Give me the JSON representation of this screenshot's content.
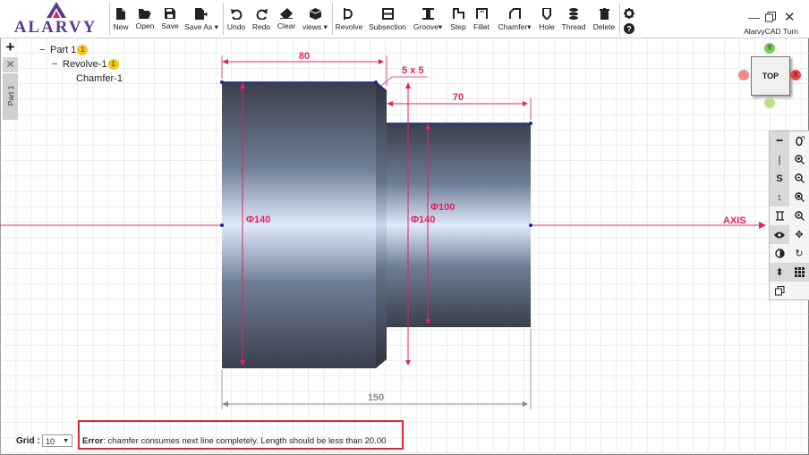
{
  "app": {
    "logo_text": "ALARVY",
    "title": "AlarvyCAD Turn"
  },
  "toolbar": {
    "file": [
      "New",
      "Open",
      "Save",
      "Save As"
    ],
    "edit": [
      "Undo",
      "Redo",
      "Clear",
      "views"
    ],
    "features": [
      "Revolve",
      "Subsection",
      "Groove",
      "Step",
      "Fillet",
      "Chamfer",
      "Hole",
      "Thread",
      "Delete"
    ]
  },
  "tabs": {
    "part_tab": "Part 1"
  },
  "tree": {
    "part": "Part 1",
    "part_badge": "1",
    "revolve": "Revolve-1",
    "revolve_badge": "1",
    "chamfer": "Chamfer-1"
  },
  "viewcube": {
    "face": "TOP",
    "y_label": "Y",
    "x_label": "X"
  },
  "drawing": {
    "dim_left_length": "80",
    "dim_chamfer": "5 x 5",
    "dim_right_length": "70",
    "dim_total_length": "150",
    "dia_left": "Φ140",
    "dia_step": "Φ140",
    "dia_right": "Φ100",
    "axis_label": "AXIS",
    "dim_color": "#e0245e",
    "body_color": "#3a3f4b"
  },
  "bottom": {
    "grid_label": "Grid :",
    "grid_value": "10",
    "error_label": "Error",
    "error_text": ": chamfer consumes next line completely. Length should be less than 20.00"
  }
}
